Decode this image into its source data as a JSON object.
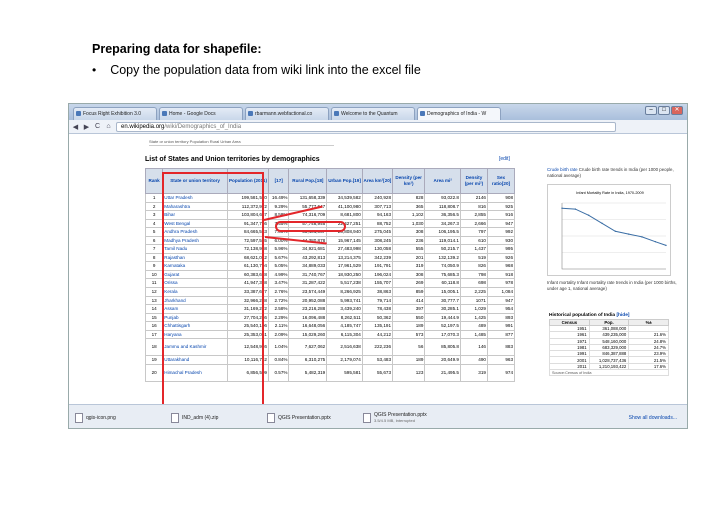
{
  "slide": {
    "title": "Preparing data for shapefile:",
    "bullet_marker": "•",
    "bullet": "Copy the population data from wiki link into the excel file"
  },
  "browser": {
    "tabs": [
      "Focus Right Exhibition 3.0",
      "Home - Google Docs",
      "rbarmann.webfactional.co",
      "Welcome to the Quantum",
      "Demographics of India - W"
    ],
    "active_tab": 4,
    "url_domain": "en.wikipedia.org",
    "url_path": "/wiki/Demographics_of_India",
    "win_buttons": [
      "–",
      "□",
      "✕"
    ],
    "nav": {
      "back": "◀",
      "forward": "▶",
      "reload": "C",
      "home": "⌂"
    }
  },
  "wiki": {
    "table_title": "List of States and Union territories by demographics",
    "edit_link": "[edit]",
    "columns": [
      "Rank",
      "State or union territory",
      "Population (2011)",
      "[17]",
      "Rural Pop.[18]",
      "Urban Pop.[19]",
      "Area km²[20]",
      "Density (per km²)",
      "Area mi²",
      "Density (per mi²)",
      "Sex ratio[20]"
    ],
    "rows": [
      [
        "1",
        "Uttar Pradesh",
        "199,581,520",
        "16.49%",
        "131,658,339",
        "34,539,582",
        "240,928",
        "828",
        "93,022.8",
        "2146",
        "908"
      ],
      [
        "2",
        "Maharashtra",
        "112,372,972",
        "9.29%",
        "55,777,647",
        "41,100,980",
        "307,713",
        "365",
        "118,808.7",
        "816",
        "925"
      ],
      [
        "3",
        "Bihar",
        "103,804,637",
        "8.58%",
        "74,316,709",
        "8,681,800",
        "94,163",
        "1,102",
        "36,356.5",
        "2,855",
        "916"
      ],
      [
        "4",
        "West Bengal",
        "91,347,736",
        "7.55%",
        "57,748,946",
        "22,427,251",
        "88,752",
        "1,030",
        "34,267.3",
        "2,666",
        "947"
      ],
      [
        "5",
        "Andhra Pradesh",
        "84,665,533",
        "7.00%",
        "55,401,067",
        "20,808,940",
        "275,045",
        "308",
        "106,195.5",
        "797",
        "992"
      ],
      [
        "6",
        "Madhya Pradesh",
        "72,597,565",
        "6.00%",
        "44,380,878",
        "15,967,145",
        "308,245",
        "236",
        "119,014.1",
        "610",
        "930"
      ],
      [
        "7",
        "Tamil Nadu",
        "72,138,958",
        "5.96%",
        "34,921,681",
        "27,483,998",
        "130,058",
        "555",
        "50,215.7",
        "1,437",
        "995"
      ],
      [
        "8",
        "Rajasthan",
        "68,621,012",
        "5.67%",
        "43,292,813",
        "13,214,375",
        "342,239",
        "201",
        "132,139.2",
        "519",
        "926"
      ],
      [
        "9",
        "Karnataka",
        "61,130,704",
        "5.05%",
        "34,889,033",
        "17,961,529",
        "191,791",
        "319",
        "74,050.9",
        "826",
        "968"
      ],
      [
        "10",
        "Gujarat",
        "60,383,628",
        "4.99%",
        "31,740,767",
        "18,930,250",
        "196,024",
        "308",
        "75,685.3",
        "798",
        "918"
      ],
      [
        "11",
        "Orissa",
        "41,947,358",
        "3.47%",
        "31,287,422",
        "5,517,238",
        "155,707",
        "269",
        "60,118.8",
        "698",
        "978"
      ],
      [
        "12",
        "Kerala",
        "33,387,677",
        "2.76%",
        "23,574,449",
        "8,266,925",
        "38,863",
        "859",
        "15,005.1",
        "2,225",
        "1,084"
      ],
      [
        "13",
        "Jharkhand",
        "32,966,238",
        "2.72%",
        "20,952,088",
        "5,993,741",
        "79,714",
        "414",
        "30,777.7",
        "1071",
        "947"
      ],
      [
        "14",
        "Assam",
        "31,169,272",
        "2.58%",
        "23,216,288",
        "3,439,240",
        "78,438",
        "397",
        "30,285.1",
        "1,029",
        "954"
      ],
      [
        "15",
        "Punjab",
        "27,704,236",
        "2.29%",
        "16,096,488",
        "8,262,511",
        "50,362",
        "550",
        "19,444.9",
        "1,425",
        "893"
      ],
      [
        "16",
        "Chhattisgarh",
        "25,540,196",
        "2.11%",
        "16,648,056",
        "4,185,747",
        "135,191",
        "189",
        "52,197.5",
        "489",
        "991"
      ],
      [
        "17",
        "Haryana",
        "25,353,081",
        "2.09%",
        "15,029,260",
        "6,115,304",
        "44,212",
        "573",
        "17,070.3",
        "1,485",
        "877"
      ],
      [
        "18",
        "Jammu and Kashmir",
        "12,548,926",
        "1.04%",
        "7,627,062",
        "2,516,638",
        "222,236",
        "56",
        "85,805.8",
        "146",
        "883"
      ],
      [
        "19",
        "Uttarakhand",
        "10,116,752",
        "0.84%",
        "6,310,275",
        "2,179,074",
        "53,483",
        "189",
        "20,649.9",
        "490",
        "963"
      ],
      [
        "20",
        "Himachal Pradesh",
        "6,856,509",
        "0.57%",
        "5,482,319",
        "595,581",
        "55,673",
        "123",
        "21,495.5",
        "319",
        "974"
      ]
    ],
    "top_caption": "State or union territory  Population  Rural  Urban  Area",
    "side_caption": "Crude birth rate trends in India (per 1000 people, national average)",
    "side_caption_link": "Crude birth rate",
    "chart_title": "Infant Mortality Rate in India, 1970-2009",
    "chart_caption": "Infant mortality rate trends in India (per 1000 births, under age 1, national average)",
    "chart_caption_link": "Infant mortality",
    "hist_title": "Historical population of India",
    "hist_hide": "[hide]",
    "hist_cols": [
      "Census",
      "Pop.",
      "%±"
    ],
    "hist_rows": [
      [
        "1951",
        "361,088,000",
        ""
      ],
      [
        "1961",
        "439,235,000",
        "21.6%"
      ],
      [
        "1971",
        "548,160,000",
        "24.8%"
      ],
      [
        "1981",
        "683,329,000",
        "24.7%"
      ],
      [
        "1991",
        "846,387,888",
        "23.9%"
      ],
      [
        "2001",
        "1,028,737,436",
        "21.5%"
      ],
      [
        "2011",
        "1,210,193,422",
        "17.6%"
      ]
    ],
    "hist_source": "Source:Census of India"
  },
  "downloads": {
    "items": [
      {
        "name": "qgis-icon.png",
        "sub": ""
      },
      {
        "name": "IND_adm (4).zip",
        "sub": ""
      },
      {
        "name": "QGIS Presentation.pptx",
        "sub": ""
      },
      {
        "name": "QGIS Presentation.pptx",
        "sub": "3.5/4.5 MB, Interrupted"
      }
    ],
    "show_all": "Show all downloads..."
  },
  "chart_data": {
    "type": "line",
    "title": "Infant Mortality Rate in India, 1970-2009",
    "series": [
      {
        "x": [
          1970,
          1975,
          1980,
          1985,
          1990,
          1995,
          2000,
          2005,
          2009
        ],
        "values": [
          129,
          127,
          114,
          97,
          80,
          74,
          68,
          58,
          50
        ]
      }
    ],
    "xlim": [
      1970,
      2009
    ],
    "ylim": [
      0,
      140
    ],
    "color": "#3b6ea5"
  },
  "colors": {
    "highlight": "#e3262a",
    "link": "#0645ad",
    "header_bg": "#d6dfeb"
  }
}
